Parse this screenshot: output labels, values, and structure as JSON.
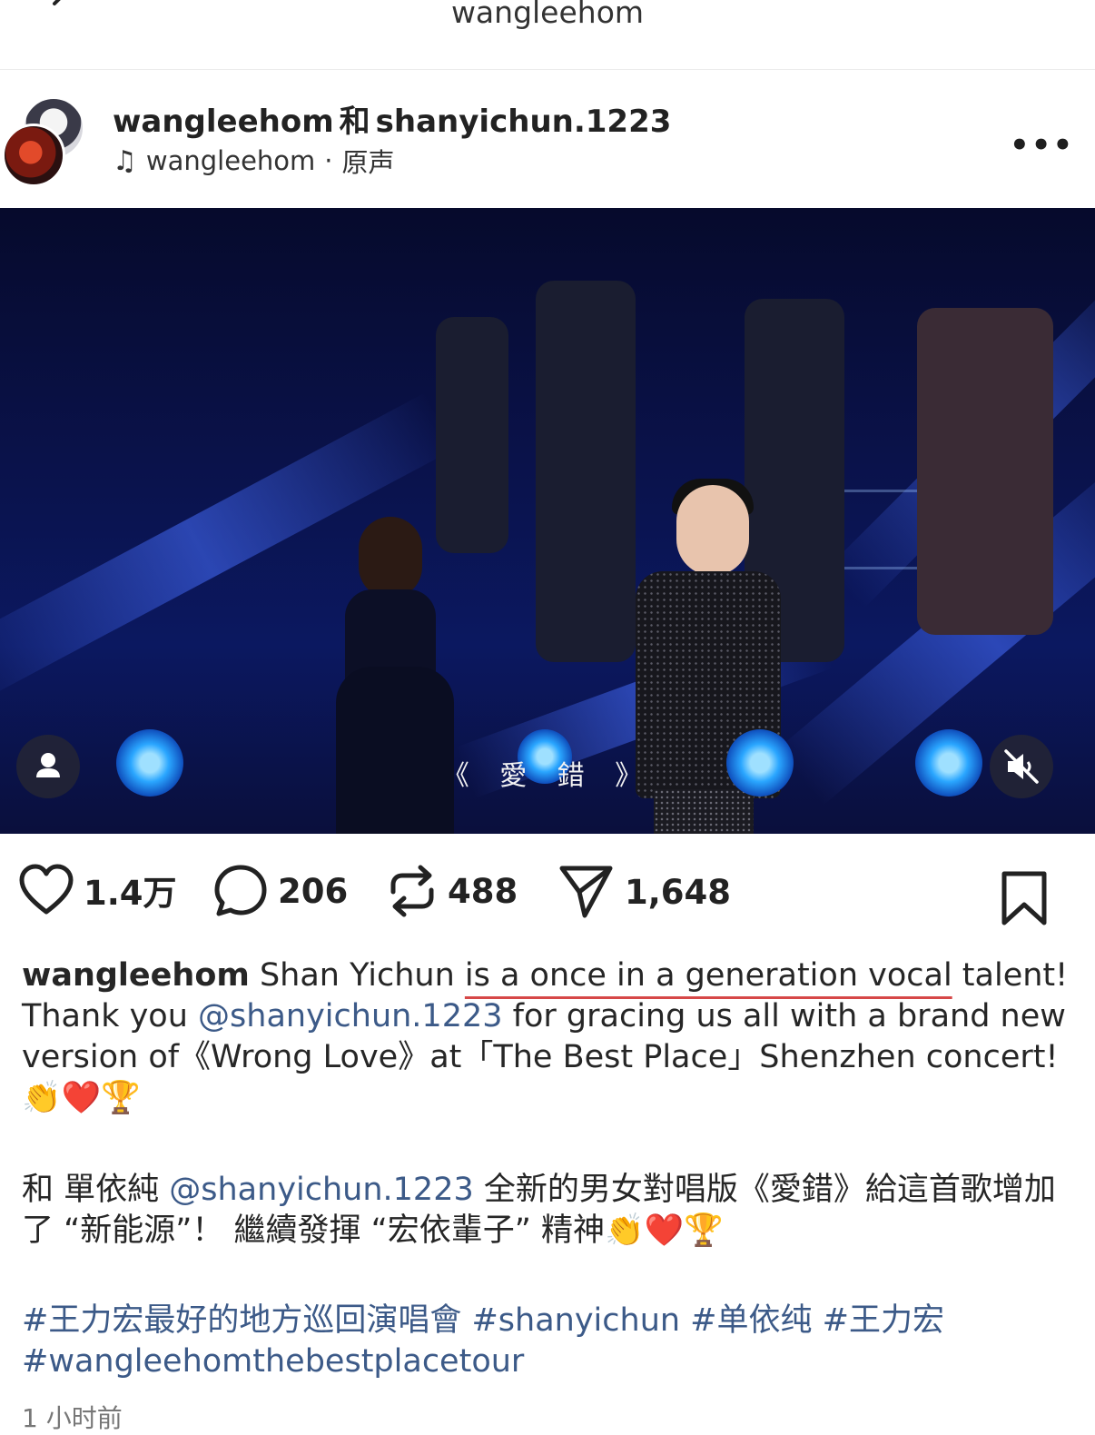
{
  "topbar": {
    "title": "wangleehom"
  },
  "post": {
    "author": "wangleehom",
    "conj": "和",
    "collaborator": "shanyichun.1223",
    "audio_owner": "wangleehom",
    "audio_sep": "·",
    "audio_label": "原声",
    "more": "•••",
    "media": {
      "song_caption": "《 愛 錯 》"
    },
    "stats": {
      "likes": "1.4万",
      "comments": "206",
      "reposts": "488",
      "shares": "1,648"
    },
    "caption": {
      "username": "wangleehom",
      "text_1": " Shan Yichun ",
      "text_underlined": "is a once in a generation vocal",
      "text_2": " talent! Thank you ",
      "mention": "@shanyichun.1223",
      "text_3": " for gracing us all with a brand new version of《Wrong Love》at「The Best Place」Shenzhen concert!",
      "emojis": "👏❤️🏆"
    },
    "caption_zh": {
      "text_1": "和 單依純 ",
      "mention": "@shanyichun.1223",
      "text_2": " 全新的男女對唱版《愛錯》給這首歌增加了 “新能源”！ 繼續發揮 “宏依輩子” 精神",
      "emojis": "👏❤️🏆"
    },
    "hashtags": "#王力宏最好的地方巡回演唱會 #shanyichun #单依纯 #王力宏 #wangleehomthebestplacetour",
    "time": "1 小时前"
  }
}
